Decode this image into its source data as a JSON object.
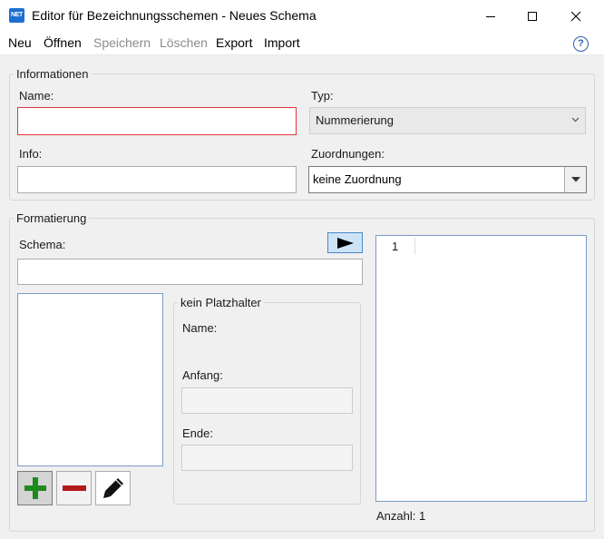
{
  "window": {
    "icon_text": "NET",
    "title": "Editor für Bezeichnungsschemen - Neues Schema"
  },
  "menu": {
    "items": [
      {
        "label": "Neu",
        "enabled": true
      },
      {
        "label": "Öffnen",
        "enabled": true
      },
      {
        "label": "Speichern",
        "enabled": false
      },
      {
        "label": "Löschen",
        "enabled": false
      },
      {
        "label": "Export",
        "enabled": true
      },
      {
        "label": "Import",
        "enabled": true
      }
    ],
    "help_symbol": "?"
  },
  "informationen": {
    "group_title": "Informationen",
    "name_label": "Name:",
    "name_value": "",
    "typ_label": "Typ:",
    "typ_value": "Nummerierung",
    "info_label": "Info:",
    "info_value": "",
    "zuordnungen_label": "Zuordnungen:",
    "zuordnungen_value": "keine Zuordnung"
  },
  "formatierung": {
    "group_title": "Formatierung",
    "schema_label": "Schema:",
    "schema_value": "",
    "placeholder": {
      "group_title": "kein Platzhalter",
      "name_label": "Name:",
      "anfang_label": "Anfang:",
      "anfang_value": "",
      "ende_label": "Ende:",
      "ende_value": ""
    },
    "preview": {
      "line_number": "1"
    },
    "anzahl_label": "Anzahl: 1"
  },
  "colors": {
    "error_border": "#e0353f",
    "play_button_bg": "#cde4f7",
    "add_icon": "#1e8a1e",
    "remove_icon": "#b31b1b"
  },
  "icons": {
    "close": "close-icon",
    "maximize": "maximize-icon",
    "minimize": "minimize-icon",
    "play": "play-icon",
    "add": "plus-icon",
    "remove": "minus-icon",
    "edit": "pencil-icon",
    "help": "help-icon"
  }
}
